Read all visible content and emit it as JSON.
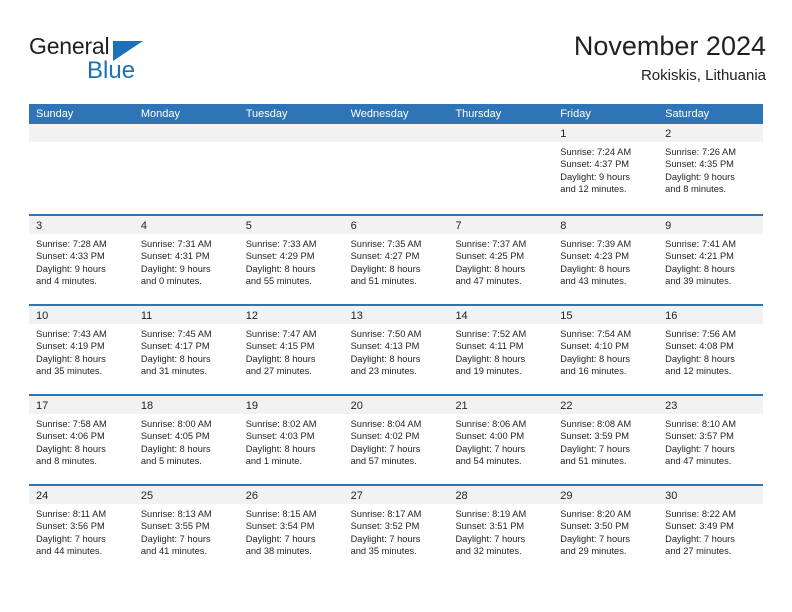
{
  "logo": {
    "word_top": "General",
    "word_bottom": "Blue",
    "accent_color": "#1b72b8"
  },
  "header": {
    "title": "November 2024",
    "location": "Rokiskis, Lithuania"
  },
  "colors": {
    "header_blue": "#2f75b5",
    "daynum_band": "#f2f2f2",
    "text": "#231f20"
  },
  "weekdays": [
    "Sunday",
    "Monday",
    "Tuesday",
    "Wednesday",
    "Thursday",
    "Friday",
    "Saturday"
  ],
  "weeks": [
    [
      {
        "day": "",
        "sunrise": "",
        "sunset": "",
        "daylight1": "",
        "daylight2": ""
      },
      {
        "day": "",
        "sunrise": "",
        "sunset": "",
        "daylight1": "",
        "daylight2": ""
      },
      {
        "day": "",
        "sunrise": "",
        "sunset": "",
        "daylight1": "",
        "daylight2": ""
      },
      {
        "day": "",
        "sunrise": "",
        "sunset": "",
        "daylight1": "",
        "daylight2": ""
      },
      {
        "day": "",
        "sunrise": "",
        "sunset": "",
        "daylight1": "",
        "daylight2": ""
      },
      {
        "day": "1",
        "sunrise": "Sunrise: 7:24 AM",
        "sunset": "Sunset: 4:37 PM",
        "daylight1": "Daylight: 9 hours",
        "daylight2": "and 12 minutes."
      },
      {
        "day": "2",
        "sunrise": "Sunrise: 7:26 AM",
        "sunset": "Sunset: 4:35 PM",
        "daylight1": "Daylight: 9 hours",
        "daylight2": "and 8 minutes."
      }
    ],
    [
      {
        "day": "3",
        "sunrise": "Sunrise: 7:28 AM",
        "sunset": "Sunset: 4:33 PM",
        "daylight1": "Daylight: 9 hours",
        "daylight2": "and 4 minutes."
      },
      {
        "day": "4",
        "sunrise": "Sunrise: 7:31 AM",
        "sunset": "Sunset: 4:31 PM",
        "daylight1": "Daylight: 9 hours",
        "daylight2": "and 0 minutes."
      },
      {
        "day": "5",
        "sunrise": "Sunrise: 7:33 AM",
        "sunset": "Sunset: 4:29 PM",
        "daylight1": "Daylight: 8 hours",
        "daylight2": "and 55 minutes."
      },
      {
        "day": "6",
        "sunrise": "Sunrise: 7:35 AM",
        "sunset": "Sunset: 4:27 PM",
        "daylight1": "Daylight: 8 hours",
        "daylight2": "and 51 minutes."
      },
      {
        "day": "7",
        "sunrise": "Sunrise: 7:37 AM",
        "sunset": "Sunset: 4:25 PM",
        "daylight1": "Daylight: 8 hours",
        "daylight2": "and 47 minutes."
      },
      {
        "day": "8",
        "sunrise": "Sunrise: 7:39 AM",
        "sunset": "Sunset: 4:23 PM",
        "daylight1": "Daylight: 8 hours",
        "daylight2": "and 43 minutes."
      },
      {
        "day": "9",
        "sunrise": "Sunrise: 7:41 AM",
        "sunset": "Sunset: 4:21 PM",
        "daylight1": "Daylight: 8 hours",
        "daylight2": "and 39 minutes."
      }
    ],
    [
      {
        "day": "10",
        "sunrise": "Sunrise: 7:43 AM",
        "sunset": "Sunset: 4:19 PM",
        "daylight1": "Daylight: 8 hours",
        "daylight2": "and 35 minutes."
      },
      {
        "day": "11",
        "sunrise": "Sunrise: 7:45 AM",
        "sunset": "Sunset: 4:17 PM",
        "daylight1": "Daylight: 8 hours",
        "daylight2": "and 31 minutes."
      },
      {
        "day": "12",
        "sunrise": "Sunrise: 7:47 AM",
        "sunset": "Sunset: 4:15 PM",
        "daylight1": "Daylight: 8 hours",
        "daylight2": "and 27 minutes."
      },
      {
        "day": "13",
        "sunrise": "Sunrise: 7:50 AM",
        "sunset": "Sunset: 4:13 PM",
        "daylight1": "Daylight: 8 hours",
        "daylight2": "and 23 minutes."
      },
      {
        "day": "14",
        "sunrise": "Sunrise: 7:52 AM",
        "sunset": "Sunset: 4:11 PM",
        "daylight1": "Daylight: 8 hours",
        "daylight2": "and 19 minutes."
      },
      {
        "day": "15",
        "sunrise": "Sunrise: 7:54 AM",
        "sunset": "Sunset: 4:10 PM",
        "daylight1": "Daylight: 8 hours",
        "daylight2": "and 16 minutes."
      },
      {
        "day": "16",
        "sunrise": "Sunrise: 7:56 AM",
        "sunset": "Sunset: 4:08 PM",
        "daylight1": "Daylight: 8 hours",
        "daylight2": "and 12 minutes."
      }
    ],
    [
      {
        "day": "17",
        "sunrise": "Sunrise: 7:58 AM",
        "sunset": "Sunset: 4:06 PM",
        "daylight1": "Daylight: 8 hours",
        "daylight2": "and 8 minutes."
      },
      {
        "day": "18",
        "sunrise": "Sunrise: 8:00 AM",
        "sunset": "Sunset: 4:05 PM",
        "daylight1": "Daylight: 8 hours",
        "daylight2": "and 5 minutes."
      },
      {
        "day": "19",
        "sunrise": "Sunrise: 8:02 AM",
        "sunset": "Sunset: 4:03 PM",
        "daylight1": "Daylight: 8 hours",
        "daylight2": "and 1 minute."
      },
      {
        "day": "20",
        "sunrise": "Sunrise: 8:04 AM",
        "sunset": "Sunset: 4:02 PM",
        "daylight1": "Daylight: 7 hours",
        "daylight2": "and 57 minutes."
      },
      {
        "day": "21",
        "sunrise": "Sunrise: 8:06 AM",
        "sunset": "Sunset: 4:00 PM",
        "daylight1": "Daylight: 7 hours",
        "daylight2": "and 54 minutes."
      },
      {
        "day": "22",
        "sunrise": "Sunrise: 8:08 AM",
        "sunset": "Sunset: 3:59 PM",
        "daylight1": "Daylight: 7 hours",
        "daylight2": "and 51 minutes."
      },
      {
        "day": "23",
        "sunrise": "Sunrise: 8:10 AM",
        "sunset": "Sunset: 3:57 PM",
        "daylight1": "Daylight: 7 hours",
        "daylight2": "and 47 minutes."
      }
    ],
    [
      {
        "day": "24",
        "sunrise": "Sunrise: 8:11 AM",
        "sunset": "Sunset: 3:56 PM",
        "daylight1": "Daylight: 7 hours",
        "daylight2": "and 44 minutes."
      },
      {
        "day": "25",
        "sunrise": "Sunrise: 8:13 AM",
        "sunset": "Sunset: 3:55 PM",
        "daylight1": "Daylight: 7 hours",
        "daylight2": "and 41 minutes."
      },
      {
        "day": "26",
        "sunrise": "Sunrise: 8:15 AM",
        "sunset": "Sunset: 3:54 PM",
        "daylight1": "Daylight: 7 hours",
        "daylight2": "and 38 minutes."
      },
      {
        "day": "27",
        "sunrise": "Sunrise: 8:17 AM",
        "sunset": "Sunset: 3:52 PM",
        "daylight1": "Daylight: 7 hours",
        "daylight2": "and 35 minutes."
      },
      {
        "day": "28",
        "sunrise": "Sunrise: 8:19 AM",
        "sunset": "Sunset: 3:51 PM",
        "daylight1": "Daylight: 7 hours",
        "daylight2": "and 32 minutes."
      },
      {
        "day": "29",
        "sunrise": "Sunrise: 8:20 AM",
        "sunset": "Sunset: 3:50 PM",
        "daylight1": "Daylight: 7 hours",
        "daylight2": "and 29 minutes."
      },
      {
        "day": "30",
        "sunrise": "Sunrise: 8:22 AM",
        "sunset": "Sunset: 3:49 PM",
        "daylight1": "Daylight: 7 hours",
        "daylight2": "and 27 minutes."
      }
    ]
  ]
}
